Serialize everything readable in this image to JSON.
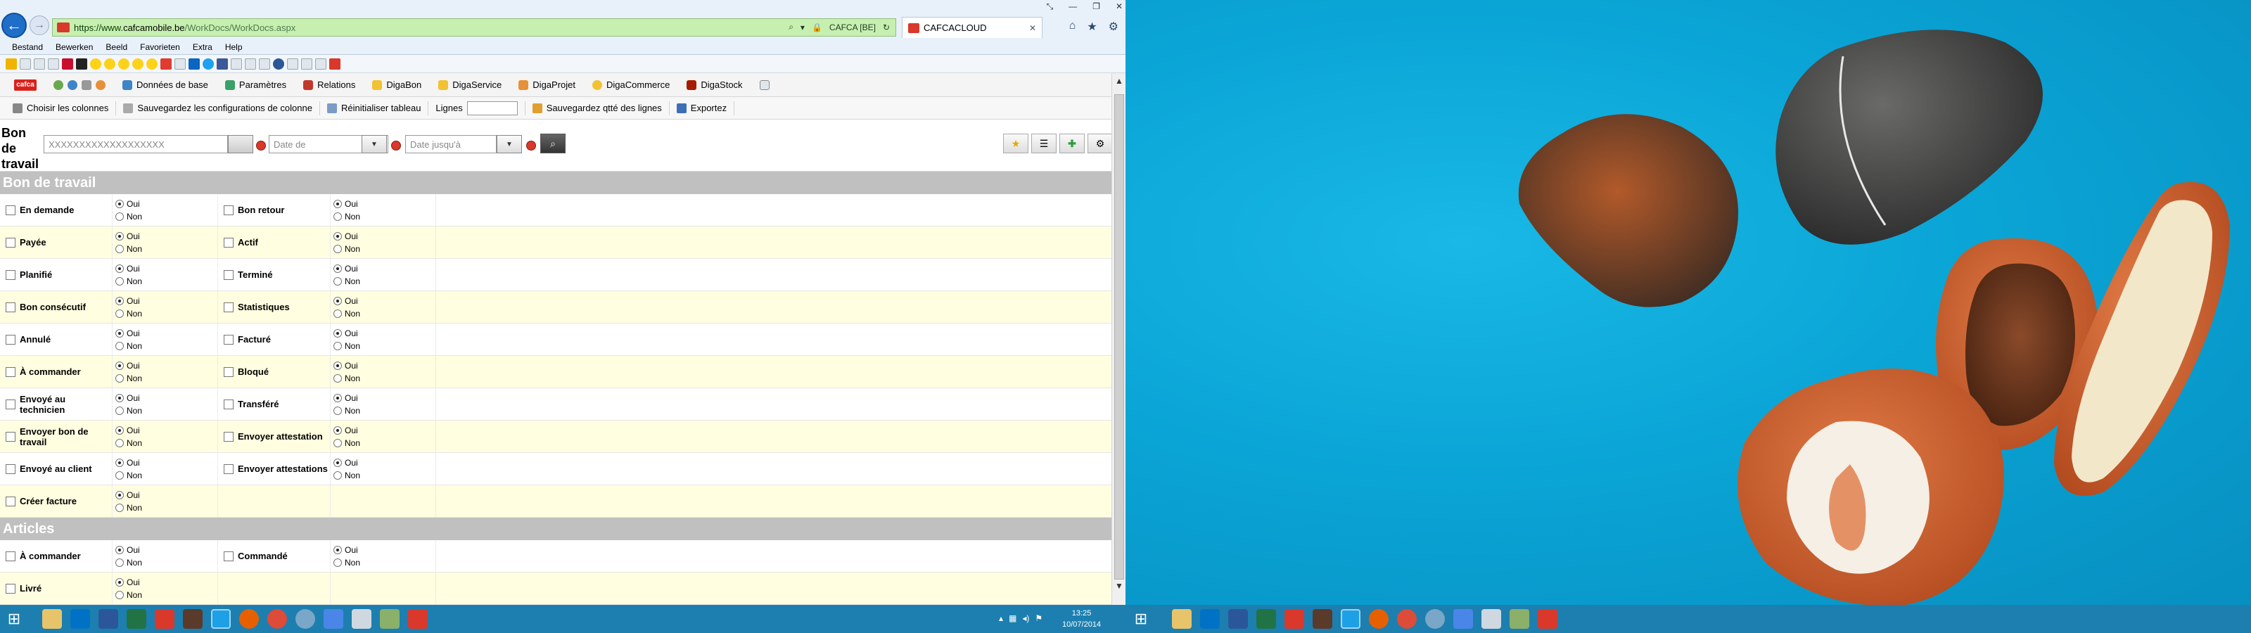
{
  "window": {
    "url_prefix": "https://www.",
    "url_host": "cafcamobile.be",
    "url_path": "/WorkDocs/WorkDocs.aspx",
    "site_identity": "CAFCA [BE]",
    "tab_title": "CAFCACLOUD"
  },
  "menubar": [
    "Bestand",
    "Bewerken",
    "Beeld",
    "Favorieten",
    "Extra",
    "Help"
  ],
  "appmenu": {
    "logo": "cafca",
    "items": [
      "Données de base",
      "Paramètres",
      "Relations",
      "DigaBon",
      "DigaService",
      "DigaProjet",
      "DigaCommerce",
      "DigaStock"
    ]
  },
  "toolbar": {
    "choose_columns": "Choisir les colonnes",
    "save_config": "Sauvegardez les configurations de colonne",
    "reset_table": "Réinitialiser tableau",
    "lignes_label": "Lignes",
    "save_qty": "Sauvegardez qtté des lignes",
    "export": "Exportez"
  },
  "filter": {
    "title": "Bon de travail",
    "code_value": "XXXXXXXXXXXXXXXXXXX",
    "date_de_placeholder": "Date de",
    "date_jusq_placeholder": "Date jusqu'à"
  },
  "options": {
    "yes": "Oui",
    "no": "Non"
  },
  "sections": [
    {
      "title": "Bon de travail",
      "rows": [
        [
          {
            "label": "En demande",
            "value": "oui"
          },
          {
            "label": "Bon retour",
            "value": "oui"
          }
        ],
        [
          {
            "label": "Payée",
            "value": "oui"
          },
          {
            "label": "Actif",
            "value": "oui"
          }
        ],
        [
          {
            "label": "Planifié",
            "value": "oui"
          },
          {
            "label": "Terminé",
            "value": "oui"
          }
        ],
        [
          {
            "label": "Bon consécutif",
            "value": "oui"
          },
          {
            "label": "Statistiques",
            "value": "oui"
          }
        ],
        [
          {
            "label": "Annulé",
            "value": "oui"
          },
          {
            "label": "Facturé",
            "value": "oui"
          }
        ],
        [
          {
            "label": "À commander",
            "value": "oui"
          },
          {
            "label": "Bloqué",
            "value": "oui"
          }
        ],
        [
          {
            "label": "Envoyé au technicien",
            "value": "oui"
          },
          {
            "label": "Transféré",
            "value": "oui"
          }
        ],
        [
          {
            "label": "Envoyer bon de travail",
            "value": "oui"
          },
          {
            "label": "Envoyer attestation",
            "value": "oui"
          }
        ],
        [
          {
            "label": "Envoyé au client",
            "value": "oui"
          },
          {
            "label": "Envoyer attestations",
            "value": "oui"
          }
        ],
        [
          {
            "label": "Créer facture",
            "value": "oui"
          }
        ]
      ]
    },
    {
      "title": "Articles",
      "rows": [
        [
          {
            "label": "À commander",
            "value": "oui"
          },
          {
            "label": "Commandé",
            "value": "oui"
          }
        ],
        [
          {
            "label": "Livré",
            "value": "oui"
          }
        ]
      ]
    }
  ],
  "taskbar": {
    "time": "13:25",
    "date": "10/07/2014"
  },
  "colors": {
    "accent_blue": "#1f6fc8",
    "address_bar_green": "#c7f0b0",
    "section_header": "#c0c0c0",
    "row_alt": "#fffee0",
    "taskbar": "#1c7fb0",
    "wallpaper": "#0aa2d3"
  }
}
